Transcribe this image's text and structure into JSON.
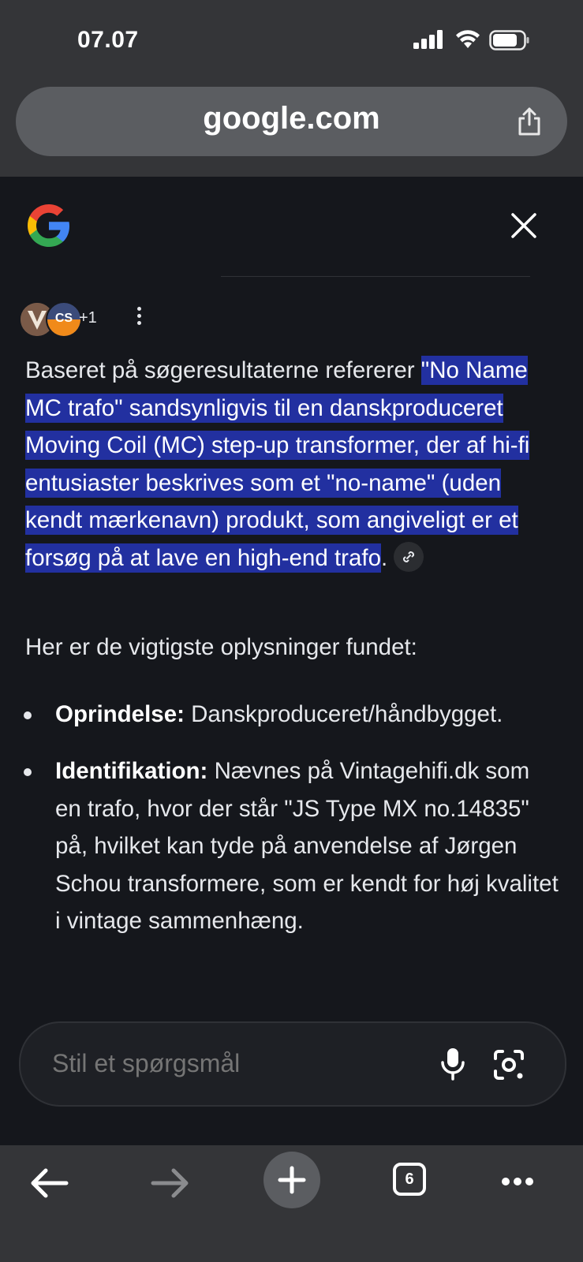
{
  "status": {
    "time": "07.07"
  },
  "browser": {
    "url": "google.com"
  },
  "panel": {
    "sources_more": "+1",
    "avatar_initials": "CS",
    "answer": {
      "lead": "Baseret på søgeresultaterne refererer ",
      "highlight": "\"No Name MC trafo\" sandsynligvis til en danskproduceret Moving Coil (MC) step-up transformer, der af hi-fi entusiaster beskrives som et \"no-name\" (uden kendt mærkenavn) produkt, som angiveligt er et forsøg på at lave en high-end trafo",
      "tail": "."
    },
    "intro": "Her er de vigtigste oplysninger fundet:",
    "bullets": [
      {
        "label": "Oprindelse:",
        "text": " Danskproduceret/håndbygget."
      },
      {
        "label": "Identifikation:",
        "text": " Nævnes på Vintagehifi.dk som en trafo, hvor der står \"JS Type MX no.14835\" på, hvilket kan tyde på anvendelse af Jørgen Schou transformere, som er kendt for høj kvalitet i vintage sammenhæng."
      }
    ]
  },
  "ask": {
    "placeholder": "Stil et spørgsmål"
  },
  "nav": {
    "tab_count": "6"
  },
  "icons": [
    "signal-icon",
    "wifi-icon",
    "battery-icon",
    "share-icon",
    "google-logo",
    "close-icon",
    "more-vert-icon",
    "link-icon",
    "mic-icon",
    "lens-icon",
    "back-icon",
    "forward-icon",
    "new-tab-icon",
    "tabs-icon",
    "more-horiz-icon"
  ],
  "colors": {
    "highlight": "#2230a0",
    "chrome": "#343538",
    "panel": "#15171c"
  }
}
